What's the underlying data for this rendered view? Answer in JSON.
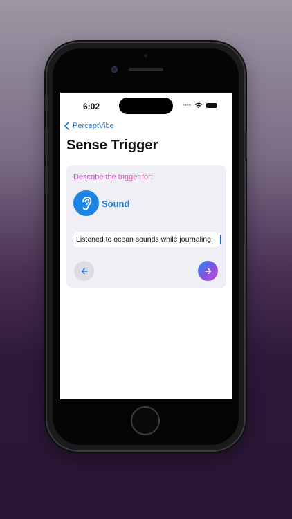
{
  "status_bar": {
    "time": "6:02",
    "signal_icon": "signal-dots-icon",
    "wifi_icon": "wifi-icon",
    "battery_icon": "battery-icon"
  },
  "nav": {
    "back_label": "PerceptVibe",
    "back_icon": "chevron-left-icon"
  },
  "page": {
    "title": "Sense Trigger"
  },
  "card": {
    "prompt": "Describe the trigger for:",
    "sense": {
      "name": "Sound",
      "icon": "ear-icon",
      "color": "#1b84e4"
    },
    "input": {
      "value": "Listened to ocean sounds while journaling."
    },
    "back_button_icon": "arrow-left-icon",
    "next_button_icon": "arrow-right-icon"
  },
  "colors": {
    "accent_blue": "#1e7ad6",
    "prompt_gradient_start": "#c44fd2",
    "prompt_gradient_end": "#e256a4",
    "card_background": "#f0eff5"
  }
}
